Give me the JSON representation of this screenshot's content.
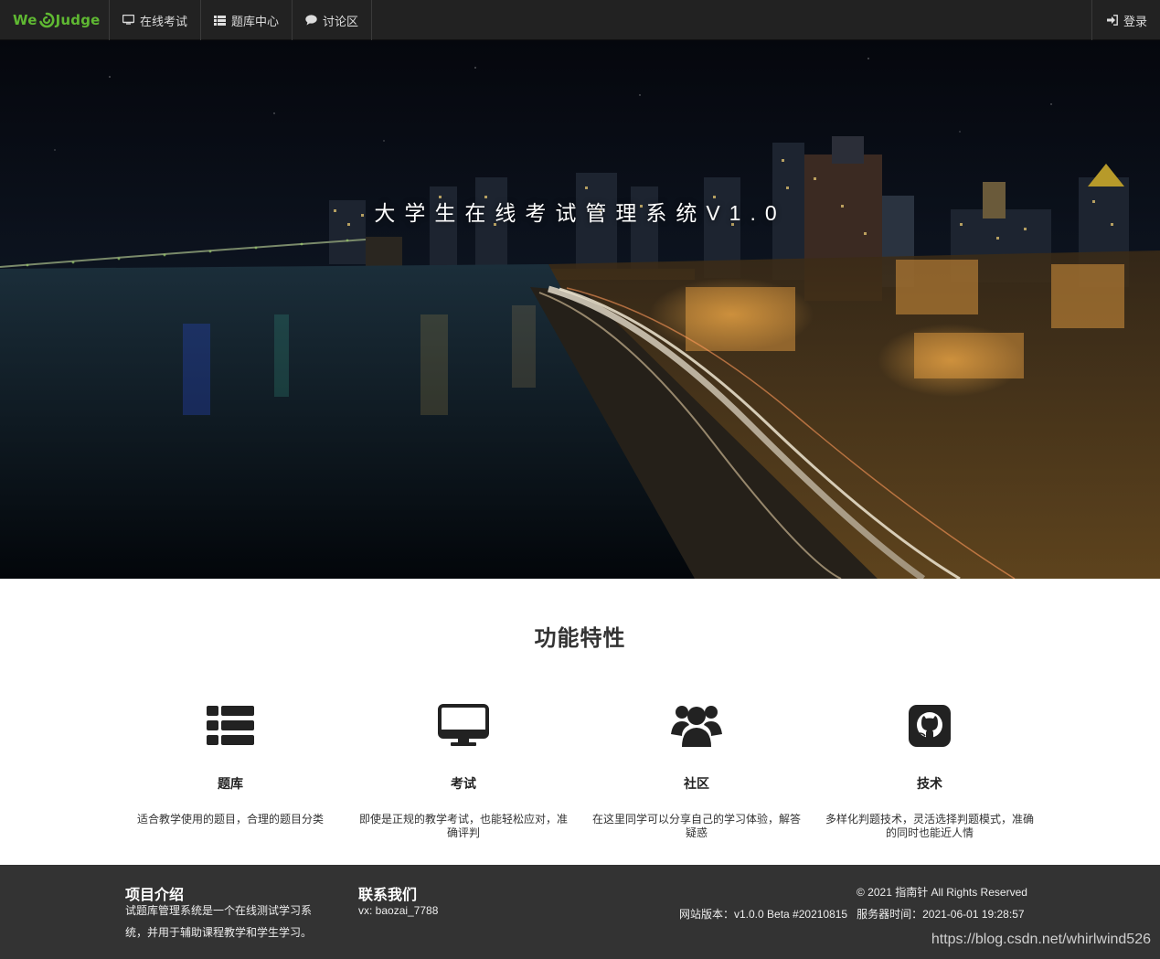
{
  "nav": {
    "brand_left": "We",
    "brand_right": "Judge",
    "items": [
      {
        "icon": "monitor-icon",
        "label": "在线考试"
      },
      {
        "icon": "list-icon",
        "label": "题库中心"
      },
      {
        "icon": "comment-icon",
        "label": "讨论区"
      }
    ],
    "login": {
      "icon": "sign-in-icon",
      "label": "登录"
    }
  },
  "hero": {
    "title": "大学生在线考试管理系统V1.0"
  },
  "features": {
    "title": "功能特性",
    "items": [
      {
        "icon": "list-icon",
        "name": "题库",
        "desc": "适合教学使用的题目，合理的题目分类"
      },
      {
        "icon": "desktop-icon",
        "name": "考试",
        "desc": "即使是正规的教学考试，也能轻松应对，准确评判"
      },
      {
        "icon": "users-icon",
        "name": "社区",
        "desc": "在这里同学可以分享自己的学习体验，解答疑惑"
      },
      {
        "icon": "github-icon",
        "name": "技术",
        "desc": "多样化判题技术，灵活选择判题模式，准确的同时也能近人情"
      }
    ]
  },
  "footer": {
    "intro_title": "项目介绍",
    "intro_text": "试题库管理系统是一个在线测试学习系统，并用于辅助课程教学和学生学习。",
    "contact_title": "联系我们",
    "contact_text": "vx: baozai_7788",
    "copyright": "© 2021 指南针 All Rights Reserved",
    "version": "网站版本：v1.0.0 Beta #20210815   服务器时间：2021-06-01 19:28:57",
    "watermark": "https://blog.csdn.net/whirlwind526"
  },
  "colors": {
    "navbar_bg": "#222222",
    "brand_green": "#5fb832",
    "footer_bg": "#333333"
  }
}
